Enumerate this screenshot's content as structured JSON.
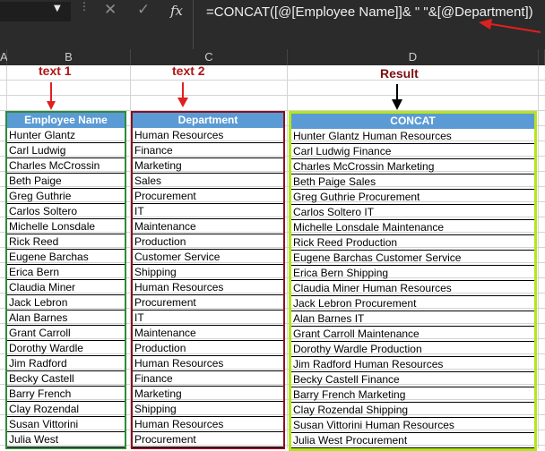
{
  "formula_bar": {
    "formula": "=CONCAT([@[Employee Name]]& \" \"&[@Department])",
    "cancel_glyph": "✕",
    "enter_glyph": "✓",
    "fx_label": "fx"
  },
  "columns": [
    "A",
    "B",
    "C",
    "D"
  ],
  "annotations": {
    "text1": "text 1",
    "text2": "text 2",
    "result": "Result"
  },
  "table": {
    "headers": [
      "Employee Name",
      "Department",
      "CONCAT"
    ],
    "rows": [
      [
        "Hunter Glantz",
        "Human Resources",
        "Hunter Glantz Human Resources"
      ],
      [
        "Carl Ludwig",
        "Finance",
        "Carl Ludwig Finance"
      ],
      [
        "Charles McCrossin",
        "Marketing",
        "Charles McCrossin Marketing"
      ],
      [
        "Beth Paige",
        "Sales",
        "Beth Paige Sales"
      ],
      [
        "Greg Guthrie",
        "Procurement",
        "Greg Guthrie Procurement"
      ],
      [
        "Carlos Soltero",
        "IT",
        "Carlos Soltero IT"
      ],
      [
        "Michelle Lonsdale",
        "Maintenance",
        "Michelle Lonsdale Maintenance"
      ],
      [
        "Rick Reed",
        "Production",
        "Rick Reed Production"
      ],
      [
        "Eugene Barchas",
        "Customer Service",
        "Eugene Barchas Customer Service"
      ],
      [
        "Erica Bern",
        "Shipping",
        "Erica Bern Shipping"
      ],
      [
        "Claudia Miner",
        "Human Resources",
        "Claudia Miner Human Resources"
      ],
      [
        "Jack Lebron",
        "Procurement",
        "Jack Lebron Procurement"
      ],
      [
        "Alan Barnes",
        "IT",
        "Alan Barnes IT"
      ],
      [
        "Grant Carroll",
        "Maintenance",
        "Grant Carroll Maintenance"
      ],
      [
        "Dorothy Wardle",
        "Production",
        "Dorothy Wardle Production"
      ],
      [
        "Jim Radford",
        "Human Resources",
        "Jim Radford Human Resources"
      ],
      [
        "Becky Castell",
        "Finance",
        "Becky Castell Finance"
      ],
      [
        "Barry French",
        "Marketing",
        "Barry French Marketing"
      ],
      [
        "Clay Rozendal",
        "Shipping",
        "Clay Rozendal Shipping"
      ],
      [
        "Susan Vittorini",
        "Human Resources",
        "Susan Vittorini Human Resources"
      ],
      [
        "Julia West",
        "Procurement",
        "Julia West Procurement"
      ]
    ]
  },
  "colors": {
    "header_fill": "#5b9bd5",
    "text1_border": "#2e8b3a",
    "text2_border": "#8b1020",
    "result_border": "#b5e61d",
    "annotation_red": "#b01818"
  }
}
